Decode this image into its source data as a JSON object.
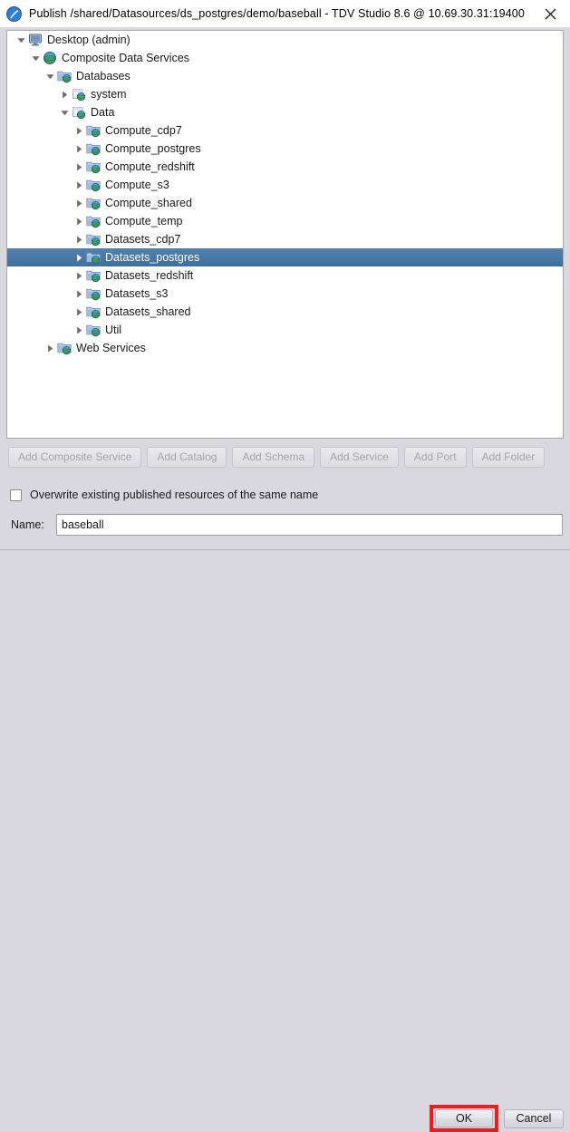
{
  "window": {
    "title": "Publish /shared/Datasources/ds_postgres/demo/baseball - TDV Studio 8.6 @ 10.69.30.31:19400",
    "app_icon": "tdv-studio-icon",
    "close_icon": "close-icon",
    "background_color": "#d8d8de",
    "selection_color": "#4a7ba6",
    "annotation_color": "#ee1c1c"
  },
  "tree": [
    {
      "label": "Desktop (admin)",
      "depth": 0,
      "icon": "monitor-icon",
      "twisty": "down",
      "selected": false
    },
    {
      "label": "Composite Data Services",
      "depth": 1,
      "icon": "globe-icon",
      "twisty": "down",
      "selected": false
    },
    {
      "label": "Databases",
      "depth": 2,
      "icon": "folder-globe-icon",
      "twisty": "down",
      "selected": false
    },
    {
      "label": "system",
      "depth": 3,
      "icon": "catalog-globe-icon",
      "twisty": "right",
      "selected": false
    },
    {
      "label": "Data",
      "depth": 3,
      "icon": "catalog-globe-icon",
      "twisty": "down",
      "selected": false
    },
    {
      "label": "Compute_cdp7",
      "depth": 4,
      "icon": "folder-globe-icon",
      "twisty": "right",
      "selected": false
    },
    {
      "label": "Compute_postgres",
      "depth": 4,
      "icon": "folder-globe-icon",
      "twisty": "right",
      "selected": false
    },
    {
      "label": "Compute_redshift",
      "depth": 4,
      "icon": "folder-globe-icon",
      "twisty": "right",
      "selected": false
    },
    {
      "label": "Compute_s3",
      "depth": 4,
      "icon": "folder-globe-icon",
      "twisty": "right",
      "selected": false
    },
    {
      "label": "Compute_shared",
      "depth": 4,
      "icon": "folder-globe-icon",
      "twisty": "right",
      "selected": false
    },
    {
      "label": "Compute_temp",
      "depth": 4,
      "icon": "folder-globe-icon",
      "twisty": "right",
      "selected": false
    },
    {
      "label": "Datasets_cdp7",
      "depth": 4,
      "icon": "folder-globe-icon",
      "twisty": "right",
      "selected": false
    },
    {
      "label": "Datasets_postgres",
      "depth": 4,
      "icon": "folder-globe-icon",
      "twisty": "right",
      "selected": true
    },
    {
      "label": "Datasets_redshift",
      "depth": 4,
      "icon": "folder-globe-icon",
      "twisty": "right",
      "selected": false
    },
    {
      "label": "Datasets_s3",
      "depth": 4,
      "icon": "folder-globe-icon",
      "twisty": "right",
      "selected": false
    },
    {
      "label": "Datasets_shared",
      "depth": 4,
      "icon": "folder-globe-icon",
      "twisty": "right",
      "selected": false
    },
    {
      "label": "Util",
      "depth": 4,
      "icon": "folder-globe-icon",
      "twisty": "right",
      "selected": false
    },
    {
      "label": "Web Services",
      "depth": 2,
      "icon": "folder-globe-icon",
      "twisty": "right",
      "selected": false
    }
  ],
  "add_buttons": [
    {
      "label": "Add Composite Service",
      "enabled": false
    },
    {
      "label": "Add Catalog",
      "enabled": false
    },
    {
      "label": "Add Schema",
      "enabled": false
    },
    {
      "label": "Add Service",
      "enabled": false
    },
    {
      "label": "Add Port",
      "enabled": false
    },
    {
      "label": "Add Folder",
      "enabled": false
    }
  ],
  "overwrite": {
    "label": "Overwrite existing published resources of the same name",
    "checked": false
  },
  "name_field": {
    "label": "Name:",
    "value": "baseball",
    "placeholder": ""
  },
  "footer": {
    "ok_label": "OK",
    "cancel_label": "Cancel"
  }
}
